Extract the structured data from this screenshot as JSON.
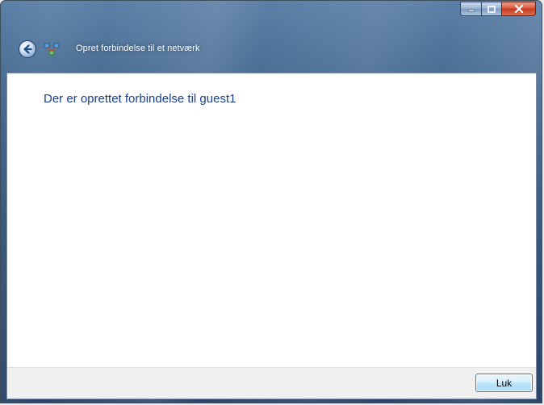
{
  "window": {
    "title": "Opret forbindelse til et netværk"
  },
  "content": {
    "heading": "Der er oprettet forbindelse til guest1"
  },
  "footer": {
    "close_label": "Luk"
  },
  "icons": {
    "back": "back-arrow-icon",
    "network": "network-icon",
    "minimize": "minimize-icon",
    "maximize": "maximize-icon",
    "close": "close-icon"
  },
  "colors": {
    "heading_text": "#1a3f8f",
    "frame": "#3f6288",
    "close_caption": "#c23a1b",
    "button_border": "#3c7fb1"
  }
}
